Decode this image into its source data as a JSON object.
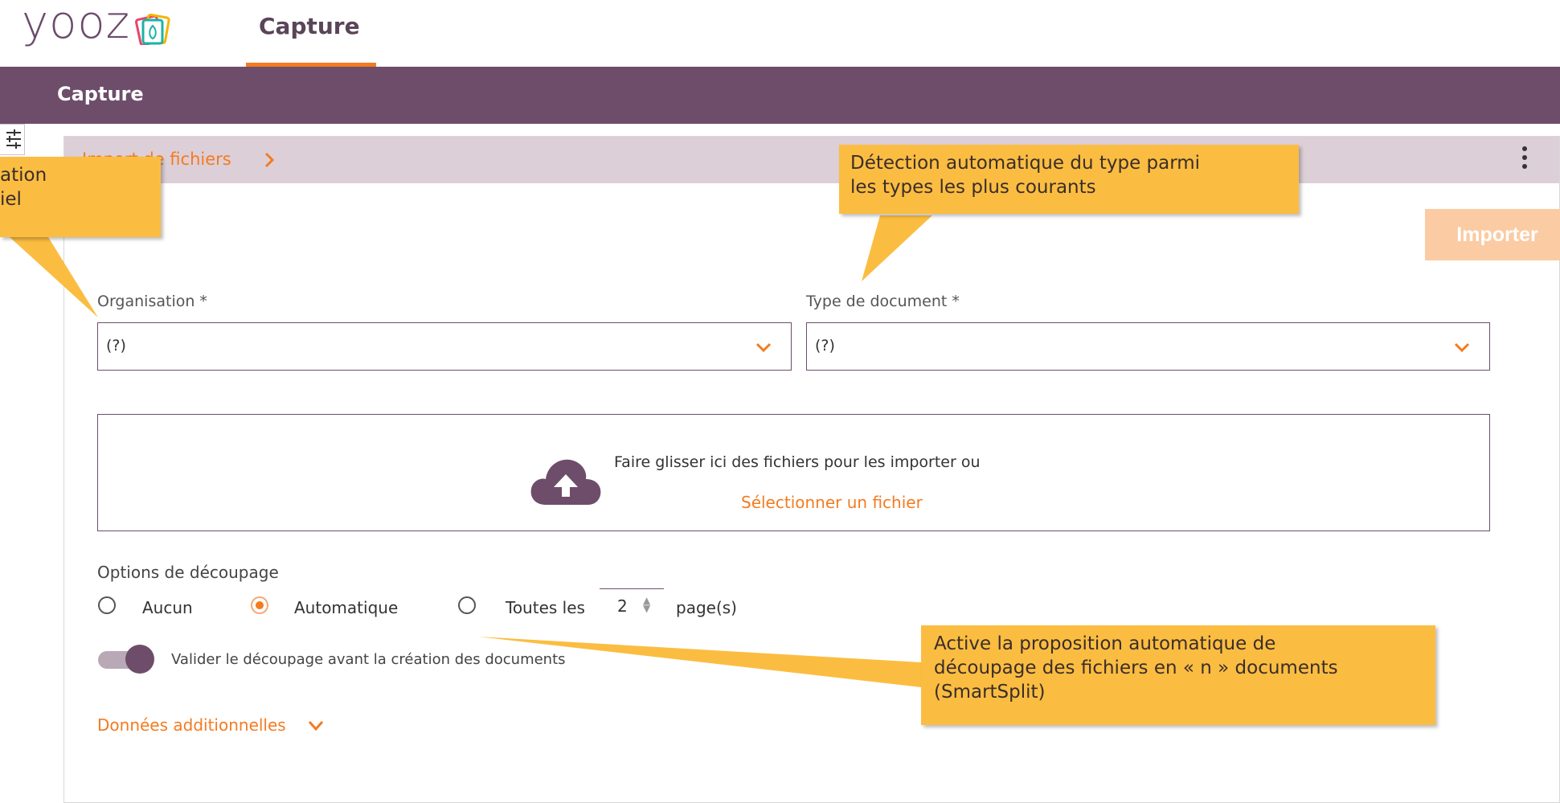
{
  "app": {
    "logo_text": "yooz"
  },
  "top_nav": {
    "tab_label": "Capture"
  },
  "section": {
    "title": "Capture"
  },
  "panel": {
    "header_label": "Import de fichiers",
    "header_chevron": "›",
    "import_button": "Importer",
    "organisation": {
      "label": "Organisation *",
      "value": "(?)"
    },
    "document_type": {
      "label": "Type de document *",
      "value": "(?)"
    },
    "dropzone": {
      "text": "Faire glisser ici des fichiers pour les importer ou",
      "link": "Sélectionner un fichier"
    },
    "split_options": {
      "title": "Options de découpage",
      "options": [
        {
          "label": "Aucun",
          "checked": false
        },
        {
          "label": "Automatique",
          "checked": true
        },
        {
          "label": "Toutes les",
          "checked": false
        }
      ],
      "pages_value": "2",
      "pages_suffix": "page(s)",
      "validate_toggle_label": "Valider le découpage avant la création des documents",
      "validate_toggle_on": true
    },
    "additional_data_label": "Données additionnelles"
  },
  "callouts": {
    "left": "ation\niel",
    "type_detection": "Détection automatique du type parmi\nles types les plus courants",
    "smartsplit": "Active la proposition automatique de\ndécoupage des fichiers en « n » documents\n(SmartSplit)"
  },
  "colors": {
    "accent": "#f47b20",
    "brand": "#6e4d6a",
    "callout": "#fbbd41",
    "panel_head": "#dccfd8"
  },
  "icons": [
    "yooz-logo-icon",
    "filter-icon",
    "chevron-right-icon",
    "kebab-icon",
    "chevron-down-icon",
    "cloud-upload-icon"
  ]
}
